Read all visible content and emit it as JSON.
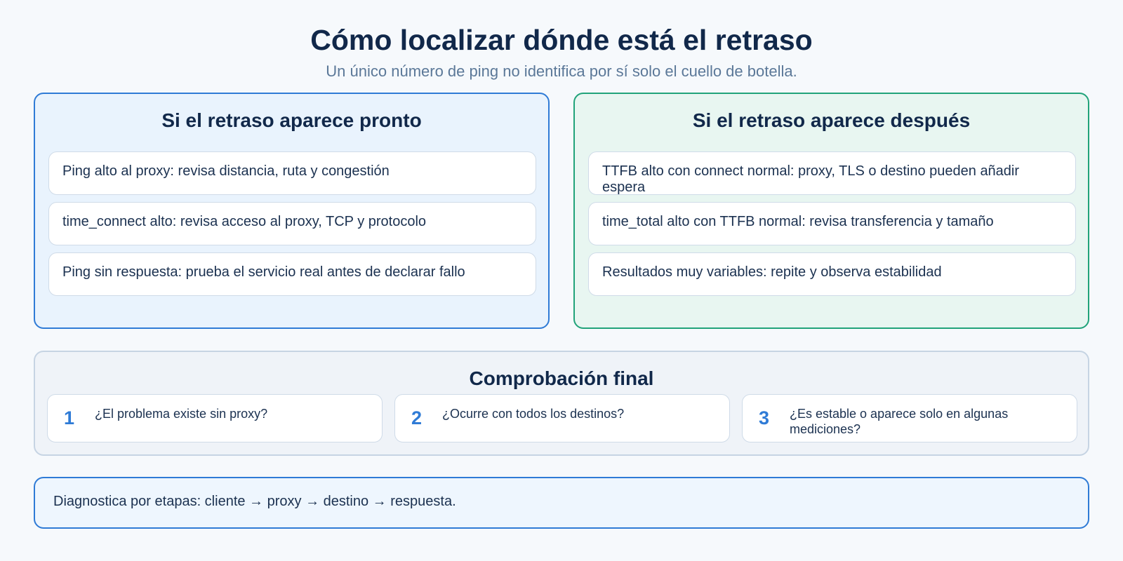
{
  "header": {
    "title": "Cómo localizar dónde está el retraso",
    "subtitle": "Un único número de ping no identifica por sí solo el cuello de botella."
  },
  "panels": [
    {
      "title": "Si el retraso aparece pronto",
      "items": [
        "Ping alto al proxy: revisa distancia, ruta y congestión",
        "time_connect alto: revisa acceso al proxy, TCP y protocolo",
        "Ping sin respuesta: prueba el servicio real antes de declarar fallo"
      ]
    },
    {
      "title": "Si el retraso aparece después",
      "items": [
        "TTFB alto con connect normal: proxy, TLS o destino pueden añadir espera",
        "time_total alto con TTFB normal: revisa transferencia y tamaño",
        "Resultados muy variables: repite y observa estabilidad"
      ]
    }
  ],
  "final_check": {
    "title": "Comprobación final",
    "steps": [
      {
        "number": "1",
        "text": "¿El problema existe sin proxy?"
      },
      {
        "number": "2",
        "text": "¿Ocurre con todos los destinos?"
      },
      {
        "number": "3",
        "text": "¿Es estable o aparece solo en algunas mediciones?"
      }
    ]
  },
  "footer": {
    "text": "Diagnostica por etapas: cliente → proxy → destino → respuesta."
  },
  "colors": {
    "left_accent": "#2f7bd6",
    "right_accent": "#21a37a",
    "title_text": "#11284a"
  }
}
